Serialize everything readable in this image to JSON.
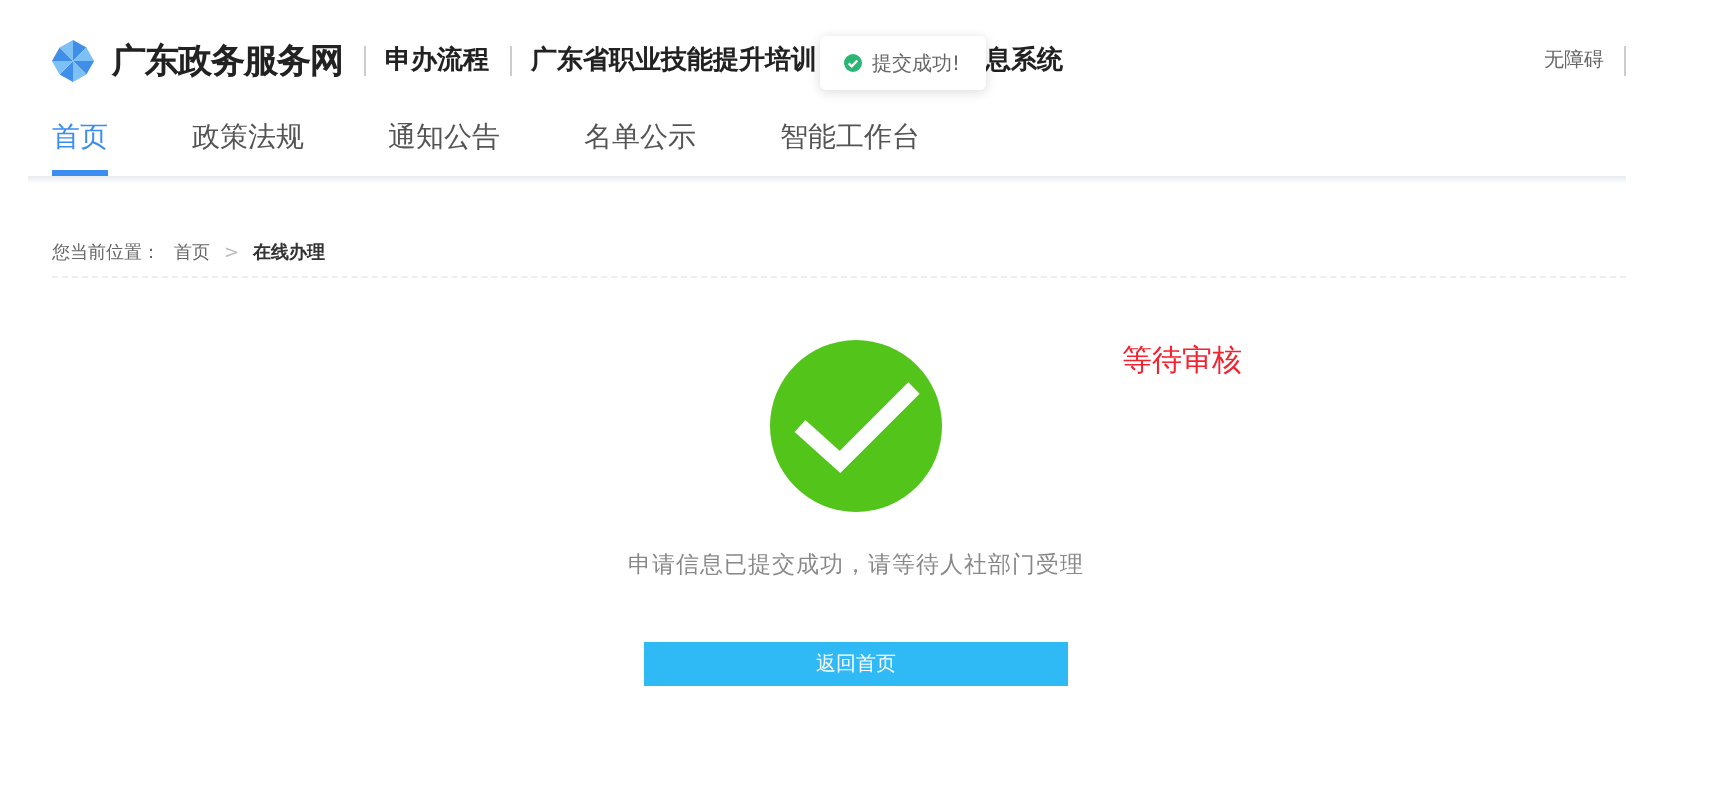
{
  "header": {
    "brand": "广东政务服务网",
    "section": "申办流程",
    "title_start": "广东省职业技能提升培训",
    "title_end": "息系统",
    "accessibility_link": "无障碍"
  },
  "toast": {
    "message": "提交成功!"
  },
  "tabs": [
    {
      "label": "首页",
      "selected": true
    },
    {
      "label": "政策法规",
      "selected": false
    },
    {
      "label": "通知公告",
      "selected": false
    },
    {
      "label": "名单公示",
      "selected": false
    },
    {
      "label": "智能工作台",
      "selected": false
    }
  ],
  "breadcrumb": {
    "prefix": "您当前位置：",
    "items": [
      {
        "label": "首页",
        "current": false
      },
      {
        "label": "在线办理",
        "current": true
      }
    ],
    "separator": ">"
  },
  "result": {
    "status": "等待审核",
    "message": "申请信息已提交成功，请等待人社部门受理",
    "button": "返回首页"
  }
}
